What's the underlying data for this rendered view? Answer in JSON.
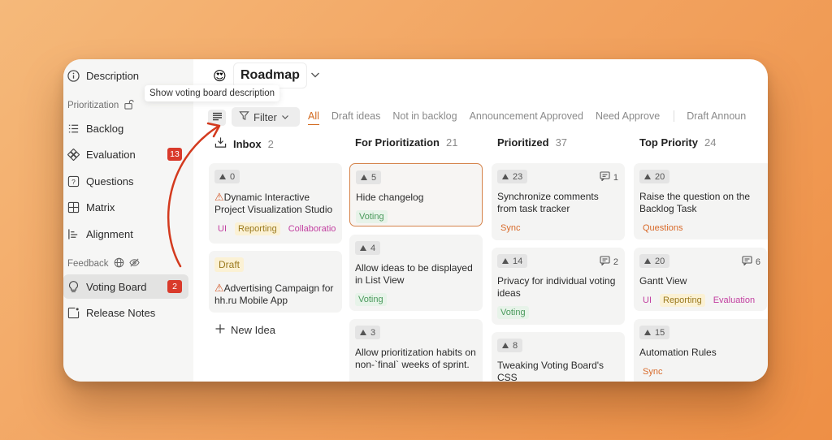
{
  "sidebar": {
    "description": "Description",
    "prioritization": "Prioritization",
    "items": [
      {
        "label": "Backlog"
      },
      {
        "label": "Evaluation",
        "badge": "13"
      },
      {
        "label": "Questions"
      },
      {
        "label": "Matrix"
      },
      {
        "label": "Alignment"
      }
    ],
    "feedback": "Feedback",
    "voting_board": {
      "label": "Voting Board",
      "badge": "2"
    },
    "release_notes": "Release Notes"
  },
  "header": {
    "emoji": "😍",
    "title": "Roadmap",
    "tooltip": "Show voting board description",
    "filter_label": "Filter"
  },
  "tabs": [
    "All",
    "Draft ideas",
    "Not in backlog",
    "Announcement Approved",
    "Need Approve",
    "Draft Announ"
  ],
  "columns": [
    {
      "name": "Inbox",
      "count": "2"
    },
    {
      "name": "For Prioritization",
      "count": "21"
    },
    {
      "name": "Prioritized",
      "count": "37"
    },
    {
      "name": "Top Priority",
      "count": "24"
    }
  ],
  "cards": {
    "inbox": [
      {
        "votes": "0",
        "title": "Dynamic Interactive Project Visualization Studio",
        "tags": [
          "UI",
          "Reporting",
          "Collaboration"
        ]
      },
      {
        "draft": "Draft",
        "title": "Advertising Campaign for hh.ru Mobile App"
      }
    ],
    "for_prioritization": [
      {
        "votes": "5",
        "title": "Hide changelog",
        "tags": [
          "Voting"
        ]
      },
      {
        "votes": "4",
        "title": "Allow ideas to be displayed in List View",
        "tags": [
          "Voting"
        ]
      },
      {
        "votes": "3",
        "title": "Allow prioritization habits on non-`final` weeks of sprint."
      }
    ],
    "prioritized": [
      {
        "votes": "23",
        "comments": "1",
        "title": "Synchronize comments from task tracker",
        "tags": [
          "Sync"
        ]
      },
      {
        "votes": "14",
        "comments": "2",
        "title": "Privacy for individual voting ideas",
        "tags": [
          "Voting"
        ]
      },
      {
        "votes": "8",
        "title": "Tweaking Voting Board's CSS"
      }
    ],
    "top_priority": [
      {
        "votes": "20",
        "title": "Raise the question on the Backlog Task",
        "tags": [
          "Questions"
        ]
      },
      {
        "votes": "20",
        "comments": "6",
        "title": "Gantt View",
        "tags": [
          "UI",
          "Reporting",
          "Evaluation"
        ]
      },
      {
        "votes": "15",
        "title": "Automation Rules",
        "tags": [
          "Sync"
        ]
      }
    ]
  },
  "new_idea": "New Idea",
  "colors": {
    "accent": "#d2691e",
    "badge": "#d93a2b",
    "arrow": "#d33a1e"
  }
}
